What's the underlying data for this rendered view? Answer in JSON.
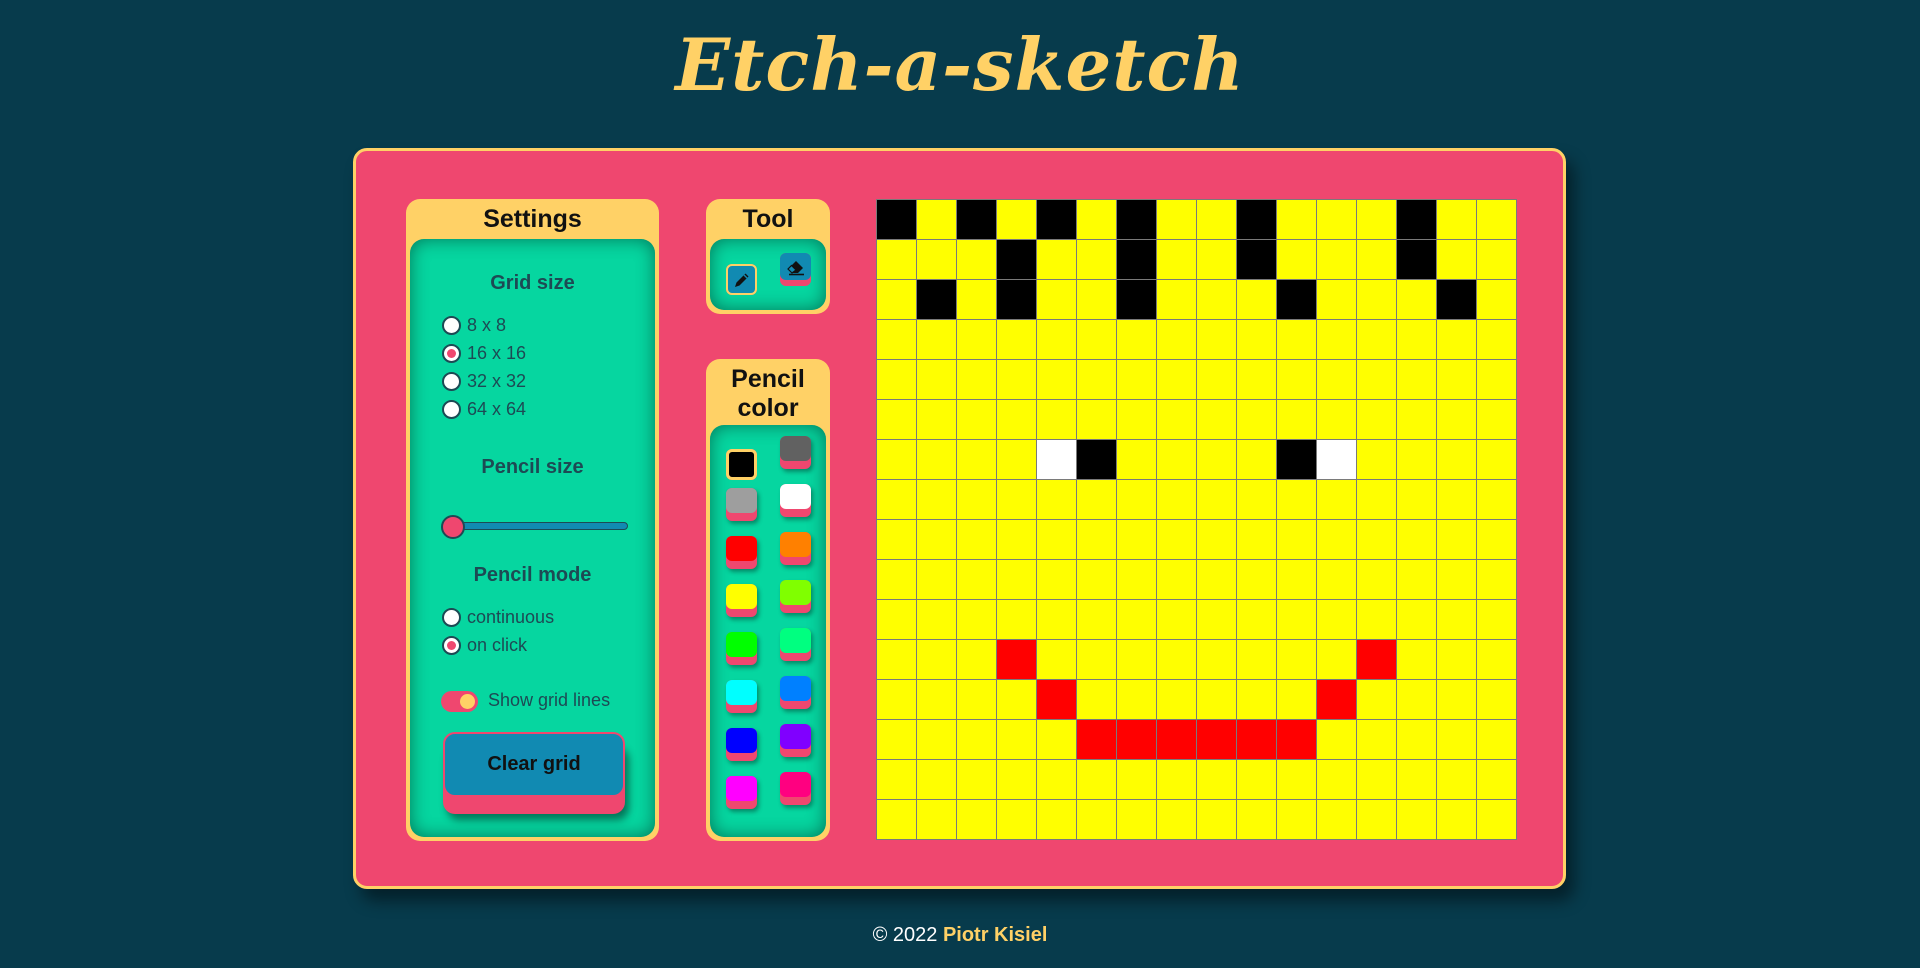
{
  "app": {
    "title": "Etch-a-sketch"
  },
  "settings": {
    "title": "Settings",
    "grid_size": {
      "title": "Grid size",
      "options": [
        "8 x 8",
        "16 x 16",
        "32 x 32",
        "64 x 64"
      ],
      "selected": "16 x 16"
    },
    "pencil_size": {
      "title": "Pencil size",
      "value": 1
    },
    "pencil_mode": {
      "title": "Pencil mode",
      "options": [
        "continuous",
        "on click"
      ],
      "selected": "on click"
    },
    "grid_lines": {
      "label": "Show grid lines",
      "on": true
    },
    "clear_label": "Clear grid"
  },
  "tool": {
    "title": "Tool",
    "items": [
      {
        "icon": "pencil-icon",
        "active": true
      },
      {
        "icon": "eraser-icon",
        "active": false
      }
    ]
  },
  "pencil_color": {
    "title": "Pencil color",
    "swatches": [
      "#000000",
      "#616161",
      "#9e9e9e",
      "#ffffff",
      "#ff0000",
      "#ff8000",
      "#ffff00",
      "#80ff00",
      "#00ff00",
      "#00ff80",
      "#00ffff",
      "#0080ff",
      "#0000ff",
      "#8000ff",
      "#ff00ff",
      "#ff0080"
    ],
    "selected": "#000000"
  },
  "grid": {
    "size": 16,
    "background": "#ffff00",
    "line_color": "#7a7a7a",
    "pixels": [
      {
        "row": 0,
        "col": 0,
        "color": "#000000"
      },
      {
        "row": 0,
        "col": 2,
        "color": "#000000"
      },
      {
        "row": 0,
        "col": 4,
        "color": "#000000"
      },
      {
        "row": 0,
        "col": 6,
        "color": "#000000"
      },
      {
        "row": 0,
        "col": 9,
        "color": "#000000"
      },
      {
        "row": 0,
        "col": 13,
        "color": "#000000"
      },
      {
        "row": 1,
        "col": 3,
        "color": "#000000"
      },
      {
        "row": 1,
        "col": 6,
        "color": "#000000"
      },
      {
        "row": 1,
        "col": 9,
        "color": "#000000"
      },
      {
        "row": 1,
        "col": 13,
        "color": "#000000"
      },
      {
        "row": 2,
        "col": 1,
        "color": "#000000"
      },
      {
        "row": 2,
        "col": 3,
        "color": "#000000"
      },
      {
        "row": 2,
        "col": 6,
        "color": "#000000"
      },
      {
        "row": 2,
        "col": 10,
        "color": "#000000"
      },
      {
        "row": 2,
        "col": 14,
        "color": "#000000"
      },
      {
        "row": 6,
        "col": 4,
        "color": "#ffffff"
      },
      {
        "row": 6,
        "col": 5,
        "color": "#000000"
      },
      {
        "row": 6,
        "col": 10,
        "color": "#000000"
      },
      {
        "row": 6,
        "col": 11,
        "color": "#ffffff"
      },
      {
        "row": 11,
        "col": 3,
        "color": "#ff0000"
      },
      {
        "row": 11,
        "col": 12,
        "color": "#ff0000"
      },
      {
        "row": 12,
        "col": 4,
        "color": "#ff0000"
      },
      {
        "row": 12,
        "col": 11,
        "color": "#ff0000"
      },
      {
        "row": 13,
        "col": 5,
        "color": "#ff0000"
      },
      {
        "row": 13,
        "col": 6,
        "color": "#ff0000"
      },
      {
        "row": 13,
        "col": 7,
        "color": "#ff0000"
      },
      {
        "row": 13,
        "col": 8,
        "color": "#ff0000"
      },
      {
        "row": 13,
        "col": 9,
        "color": "#ff0000"
      },
      {
        "row": 13,
        "col": 10,
        "color": "#ff0000"
      }
    ]
  },
  "footer": {
    "copyright": "© 2022",
    "author": "Piotr Kisiel"
  }
}
